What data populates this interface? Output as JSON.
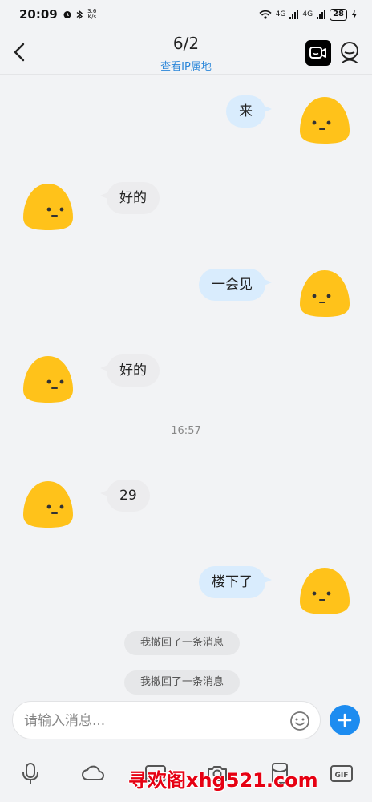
{
  "status_bar": {
    "time": "20:09",
    "net_speed_value": "3.6",
    "net_speed_unit": "K/s",
    "net_type_1": "4G",
    "net_type_2": "4G",
    "battery": "28"
  },
  "header": {
    "title": "6/2",
    "subtitle": "查看IP属地",
    "back_icon": "chevron-left-icon",
    "video_icon": "video-call-icon",
    "profile_icon": "profile-icon"
  },
  "messages": [
    {
      "side": "out",
      "text": "来"
    },
    {
      "side": "in",
      "text": "好的"
    },
    {
      "side": "out",
      "text": "一会见"
    },
    {
      "side": "in",
      "text": "好的"
    },
    {
      "side": "in",
      "text": "29"
    },
    {
      "side": "out",
      "text": "楼下了"
    }
  ],
  "timestamp": "16:57",
  "system_notices": [
    "我撤回了一条消息",
    "我撤回了一条消息"
  ],
  "composer": {
    "placeholder": "请输入消息...",
    "emoji_icon": "emoji-icon",
    "add_icon": "plus-icon"
  },
  "toolbar": [
    "microphone-icon",
    "cloud-icon",
    "image-icon",
    "camera-icon",
    "hongbao-icon",
    "gif-icon"
  ],
  "watermark": "寻欢阁xhg521.com",
  "colors": {
    "accent": "#1d8cf0",
    "link": "#2a86d9",
    "bubble_out": "#d9ecfd",
    "bubble_in": "#ececee",
    "avatar": "#ffc21a",
    "watermark": "#e60012"
  }
}
